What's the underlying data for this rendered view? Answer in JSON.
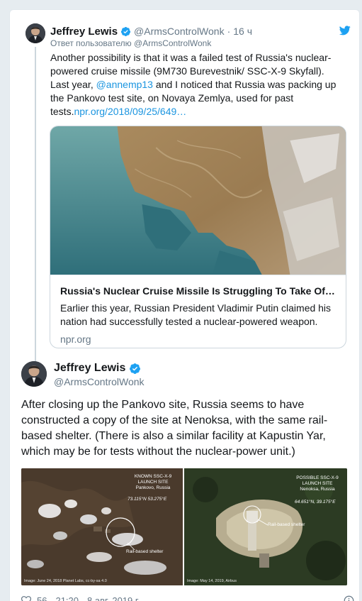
{
  "quoted_tweet": {
    "author_name": "Jeffrey Lewis",
    "handle": "@ArmsControlWonk",
    "separator": "·",
    "time": "16 ч",
    "reply_prefix": "Ответ пользователю",
    "reply_handle": "@ArmsControlWonk",
    "text_part1": "Another possibility is that it was a failed test of Russia's nuclear-powered cruise missile (9M730 Burevestnik/ SSC-X-9 Skyfall). Last year, ",
    "mention": "@annemp13",
    "text_part2": " and I noticed that Russia was packing up the Pankovo test site, on Novaya Zemlya, used for past tests.",
    "link": "npr.org/2018/09/25/649…",
    "card": {
      "title": "Russia's Nuclear Cruise Missile Is Struggling To Take Of…",
      "description": "Earlier this year, Russian President Vladimir Putin claimed his nation had successfully tested a nuclear-powered weapon.",
      "domain": "npr.org"
    }
  },
  "main_tweet": {
    "author_name": "Jeffrey Lewis",
    "handle": "@ArmsControlWonk",
    "text": "After closing up the Pankovo site, Russia seems to have constructed a copy of the site at Nenoksa, with the same rail-based shelter.  (There is also a similar facility at Kapustin Yar, which may be for tests without the nuclear-power unit.)",
    "photos": [
      {
        "label_lines": [
          "KNOWN SSC-X-9",
          "LAUNCH SITE",
          "Pankovo, Russia"
        ],
        "coords": "73.115°N  53.275°E",
        "shelter_label": "Rail-based shelter",
        "credit": "Image: June 24, 2018 Planet Labs, cc-by-sa 4.0"
      },
      {
        "label_lines": [
          "POSSIBLE SSC-X-9",
          "LAUNCH SITE",
          "Nenoksa, Russia"
        ],
        "coords": "64.651°N, 39.175°E",
        "shelter_label": "Rail-based shelter",
        "credit": "Image: May 14, 2019, Airbus"
      }
    ],
    "likes": "56",
    "time": "21:20",
    "date": "8 авг. 2019 г."
  },
  "colors": {
    "link": "#1b95e0",
    "verified": "#1da1f2",
    "secondary_text": "#657786"
  }
}
